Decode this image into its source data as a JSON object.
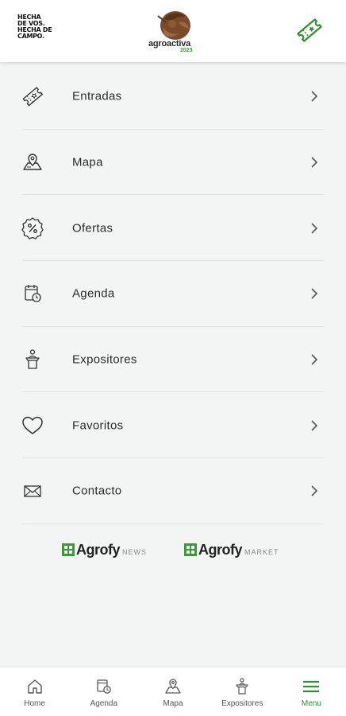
{
  "header": {
    "slogan_lines": [
      "Hecha",
      "de vos.",
      "Hecha de",
      "campo."
    ],
    "logo_word": "agroactiva",
    "logo_year": "2023",
    "ticket_icon": "ticket-icon"
  },
  "menu": {
    "items": [
      {
        "label": "Entradas",
        "icon": "ticket-icon"
      },
      {
        "label": "Mapa",
        "icon": "map-icon"
      },
      {
        "label": "Ofertas",
        "icon": "percent-badge-icon"
      },
      {
        "label": "Agenda",
        "icon": "calendar-clock-icon"
      },
      {
        "label": "Expositores",
        "icon": "podium-speaker-icon"
      },
      {
        "label": "Favoritos",
        "icon": "heart-icon"
      },
      {
        "label": "Contacto",
        "icon": "mail-icon"
      }
    ]
  },
  "partners": [
    {
      "name": "Agrofy",
      "tag": "NEWS"
    },
    {
      "name": "Agrofy",
      "tag": "MARKET"
    }
  ],
  "bottom_nav": {
    "items": [
      {
        "label": "Home",
        "icon": "home-icon"
      },
      {
        "label": "Agenda",
        "icon": "calendar-clock-icon"
      },
      {
        "label": "Mapa",
        "icon": "map-icon"
      },
      {
        "label": "Expositores",
        "icon": "podium-speaker-icon"
      },
      {
        "label": "Menu",
        "icon": "hamburger-menu-icon"
      }
    ],
    "active_index": 4
  },
  "colors": {
    "brand_green": "#2f8f2f",
    "background": "#f3f4f4",
    "divider": "#dfe2e2"
  }
}
